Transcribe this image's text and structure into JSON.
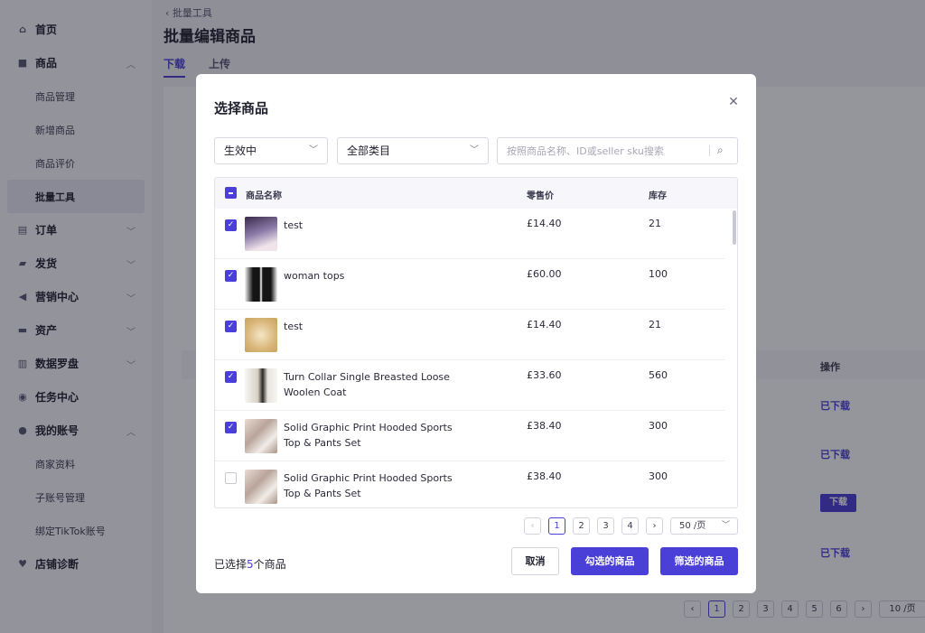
{
  "sidebar": {
    "items": [
      {
        "label": "首页",
        "icon": "home-icon"
      },
      {
        "label": "商品",
        "icon": "product-icon",
        "expanded": true,
        "children": [
          "商品管理",
          "新增商品",
          "商品评价",
          "批量工具"
        ]
      },
      {
        "label": "订单",
        "icon": "order-icon"
      },
      {
        "label": "发货",
        "icon": "truck-icon"
      },
      {
        "label": "营销中心",
        "icon": "megaphone-icon"
      },
      {
        "label": "资产",
        "icon": "wallet-icon"
      },
      {
        "label": "数据罗盘",
        "icon": "chart-icon"
      },
      {
        "label": "任务中心",
        "icon": "task-icon"
      },
      {
        "label": "我的账号",
        "icon": "user-icon",
        "expanded": true,
        "children": [
          "商家资料",
          "子账号管理",
          "绑定TikTok账号"
        ]
      },
      {
        "label": "店铺诊断",
        "icon": "diagnosis-icon"
      }
    ],
    "active_child": "批量工具"
  },
  "page": {
    "breadcrumb": "批量工具",
    "title": "批量编辑商品",
    "tabs": [
      "下载",
      "上传"
    ],
    "active_tab": "下载",
    "bg_table": {
      "op_header": "操作",
      "row_actions": [
        "已下载",
        "已下载",
        "下载",
        "已下载"
      ]
    },
    "bg_pager": {
      "pages": [
        "1",
        "2",
        "3",
        "4",
        "5",
        "6"
      ],
      "current": "1",
      "page_size": "10 /页"
    }
  },
  "modal": {
    "title": "选择商品",
    "filters": {
      "status": "生效中",
      "category": "全部类目",
      "search_placeholder": "按照商品名称、ID或seller sku搜索"
    },
    "table": {
      "headers": {
        "name": "商品名称",
        "price": "零售价",
        "stock": "库存"
      },
      "rows": [
        {
          "checked": true,
          "name": "test",
          "price": "£14.40",
          "stock": "21",
          "thumb_color": "#6b5a8c"
        },
        {
          "checked": true,
          "name": "woman tops",
          "price": "£60.00",
          "stock": "100",
          "thumb_color": "#1a1a1a"
        },
        {
          "checked": true,
          "name": "test",
          "price": "£14.40",
          "stock": "21",
          "thumb_color": "#d9b77a"
        },
        {
          "checked": true,
          "name": "Turn Collar Single Breasted Loose Woolen Coat",
          "price": "£33.60",
          "stock": "560",
          "thumb_color": "#d8d0c4"
        },
        {
          "checked": true,
          "name": "Solid Graphic Print Hooded Sports Top & Pants Set",
          "price": "£38.40",
          "stock": "300",
          "thumb_color": "#c8b8b0"
        },
        {
          "checked": false,
          "name": "Solid Graphic Print Hooded Sports Top & Pants Set",
          "price": "£38.40",
          "stock": "300",
          "thumb_color": "#c8b8b0"
        }
      ]
    },
    "pager": {
      "prev": "‹",
      "pages": [
        "1",
        "2",
        "3",
        "4"
      ],
      "current": "1",
      "next": "›",
      "page_size": "50 /页"
    },
    "footer": {
      "selected_prefix": "已选择",
      "selected_count": "5",
      "selected_suffix": "个商品",
      "cancel": "取消",
      "confirm_checked": "勾选的商品",
      "confirm_filtered": "筛选的商品"
    }
  },
  "colors": {
    "accent": "#4a3fd6",
    "overlay": "rgba(20,20,35,0.45)"
  }
}
